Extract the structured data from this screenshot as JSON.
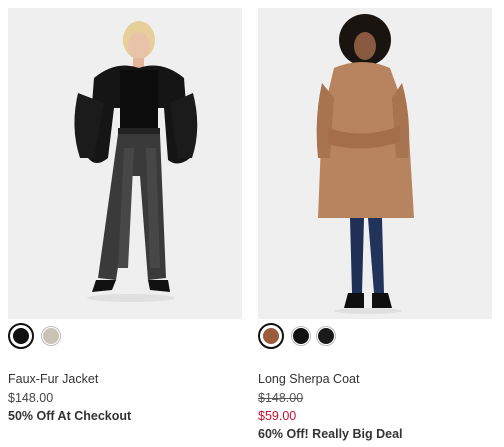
{
  "products": [
    {
      "name": "Faux-Fur Jacket",
      "price": "$148.00",
      "promo": "50% Off At Checkout",
      "image_icon": "product-photo-faux-fur-jacket",
      "swatches": [
        {
          "color": "#111111",
          "selected": true
        },
        {
          "color": "#c9c2b6",
          "selected": false
        }
      ]
    },
    {
      "name": "Long Sherpa Coat",
      "original_price": "$148.00",
      "sale_price": "$59.00",
      "promo": "60% Off! Really Big Deal",
      "image_icon": "product-photo-long-sherpa-coat",
      "swatches": [
        {
          "color": "#9a5c3a",
          "selected": true
        },
        {
          "color": "#111111",
          "selected": false
        },
        {
          "color": "#1a1a1a",
          "selected": false
        }
      ]
    }
  ],
  "colors": {
    "sale": "#c8102e",
    "text": "#333333",
    "photo_bg": "#f1f1f1"
  }
}
